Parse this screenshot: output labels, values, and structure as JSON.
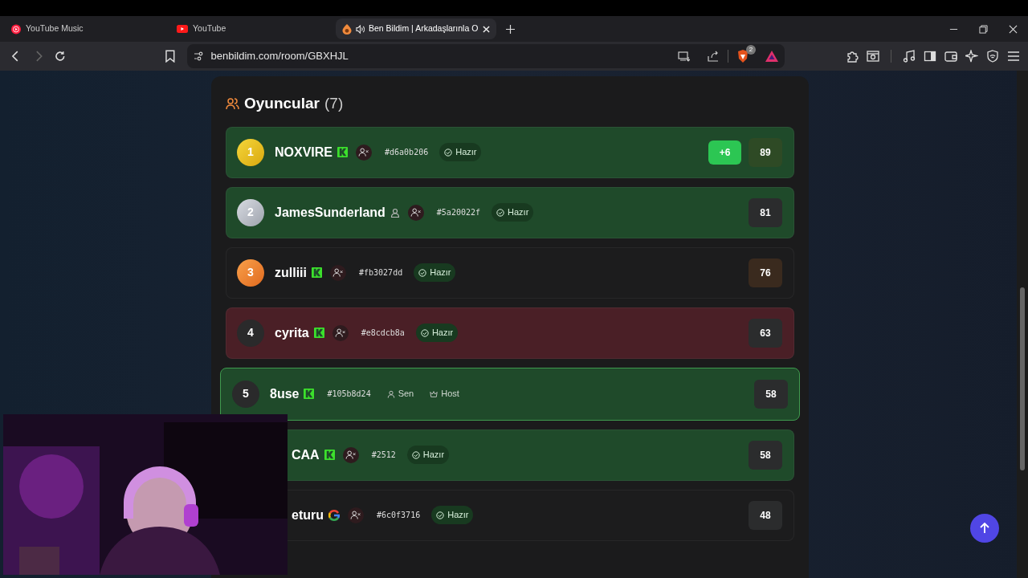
{
  "tabs": [
    {
      "title": "YouTube Music",
      "selected": false,
      "audio": false
    },
    {
      "title": "YouTube",
      "selected": false,
      "audio": false
    },
    {
      "title": "Ben Bildim | Arkadaşlarınla O",
      "selected": true,
      "audio": true
    }
  ],
  "address": "benbildim.com/room/GBXHJL",
  "shields_count": "2",
  "section": {
    "title": "Oyuncular",
    "count": "(7)"
  },
  "players": [
    {
      "rank": {
        "label": "1",
        "kind": "gold"
      },
      "color": "#1f4a2a",
      "self": false,
      "name": "NOXVIRE",
      "account": {
        "kind": "kick"
      },
      "can_add": true,
      "tag": "#d6a0b206",
      "badges": [
        {
          "kind": "ready",
          "label": "Hazır"
        }
      ],
      "delta": "+6",
      "score": "89"
    },
    {
      "rank": {
        "label": "2",
        "kind": "silver"
      },
      "color": "#1f4a2a",
      "self": false,
      "name": "JamesSunderland",
      "account": {
        "kind": "guest"
      },
      "can_add": true,
      "tag": "#5a20022f",
      "badges": [
        {
          "kind": "ready",
          "label": "Hazır"
        }
      ],
      "score": "81"
    },
    {
      "rank": {
        "label": "3",
        "kind": "bronze"
      },
      "color": "#1c1c1d",
      "self": false,
      "name": "zulliii",
      "account": {
        "kind": "kick"
      },
      "can_add": true,
      "tag": "#fb3027dd",
      "badges": [
        {
          "kind": "ready",
          "label": "Hazır"
        }
      ],
      "score": "76"
    },
    {
      "rank": {
        "label": "4",
        "kind": "plain"
      },
      "color": "#4a1f26",
      "self": false,
      "name": "cyrita",
      "account": {
        "kind": "kick"
      },
      "can_add": true,
      "tag": "#e8cdcb8a",
      "badges": [
        {
          "kind": "ready",
          "label": "Hazır"
        }
      ],
      "score": "63"
    },
    {
      "rank": {
        "label": "5",
        "kind": "plain"
      },
      "color": "#1f4a2a",
      "self": true,
      "name": "8use",
      "account": {
        "kind": "kick"
      },
      "can_add": false,
      "tag": "#105b8d24",
      "badges": [
        {
          "kind": "you",
          "label": "Sen"
        },
        {
          "kind": "host",
          "label": "Host"
        }
      ],
      "score": "58"
    },
    {
      "color": "#1f4a2a",
      "self": false,
      "name": "CAA",
      "account": {
        "kind": "kick"
      },
      "can_add": true,
      "tag": "#2512",
      "badges": [
        {
          "kind": "ready",
          "label": "Hazır"
        }
      ],
      "score": "58"
    },
    {
      "color": "#1c1c1d",
      "self": false,
      "name": "eturu",
      "account": {
        "kind": "google"
      },
      "can_add": true,
      "tag": "#6c0f3716",
      "badges": [
        {
          "kind": "ready",
          "label": "Hazır"
        }
      ],
      "score": "48"
    }
  ]
}
